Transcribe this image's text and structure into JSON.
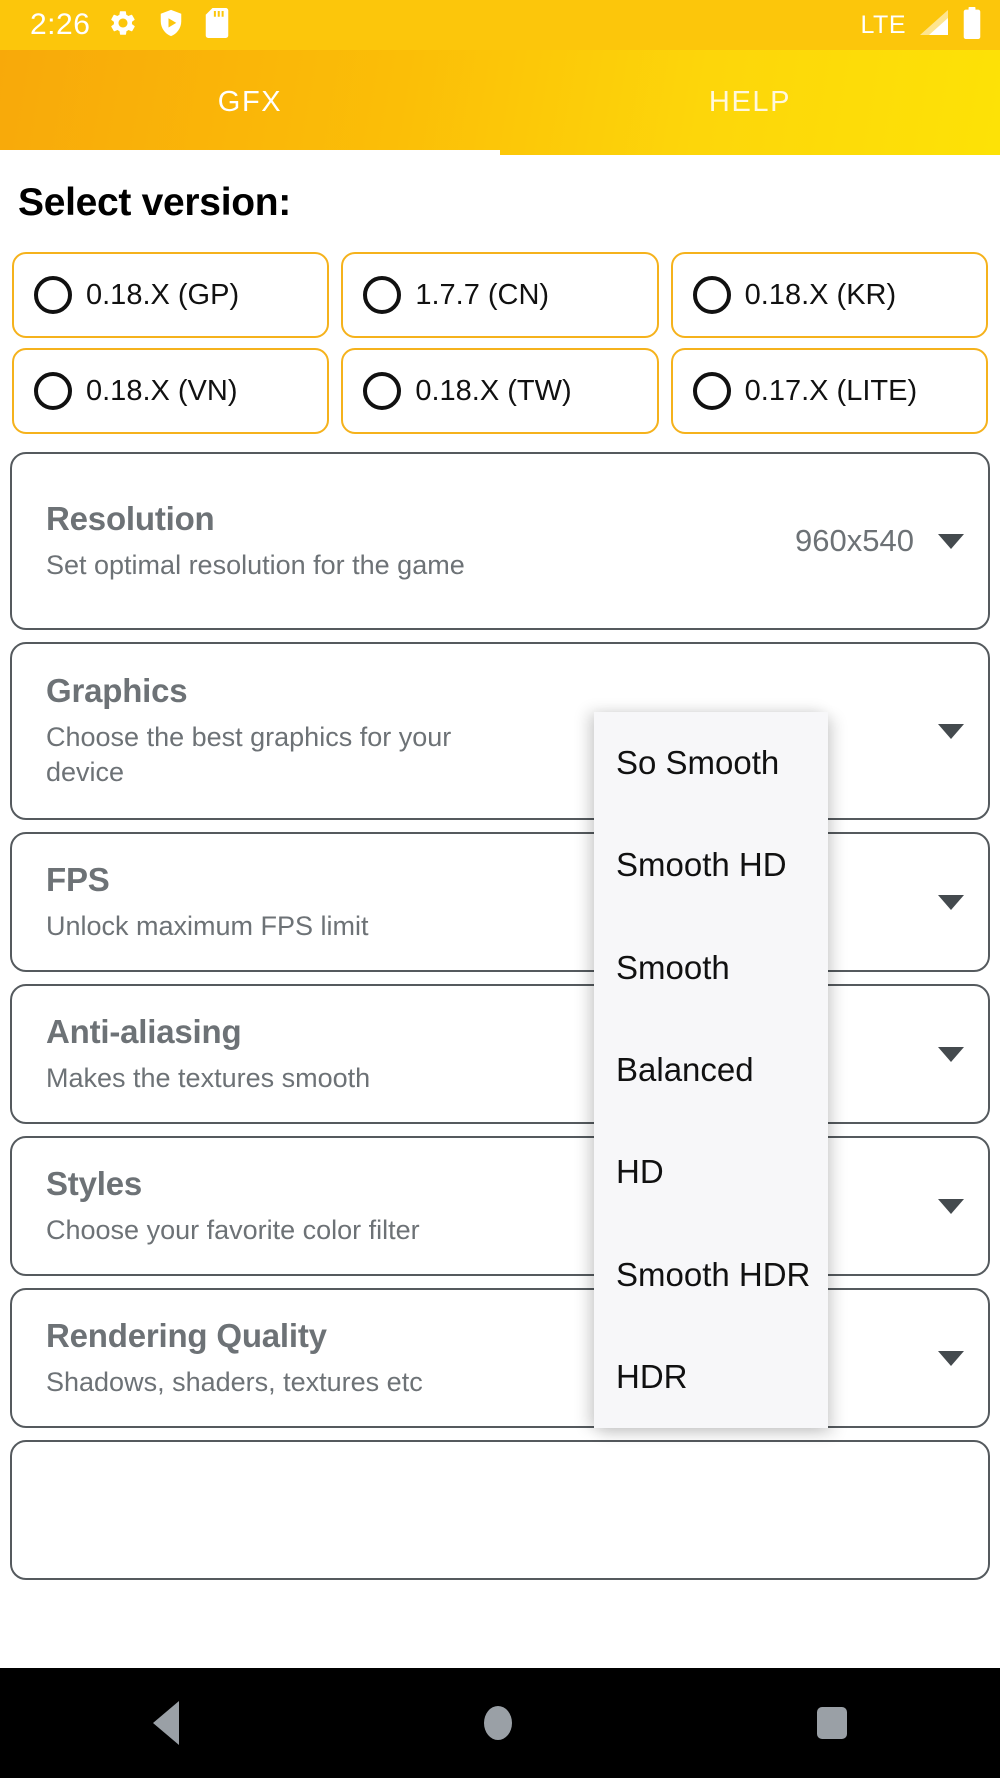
{
  "status_bar": {
    "time": "2:26",
    "left_icons": [
      "gear-icon",
      "play-protect-shield-icon",
      "sd-card-icon"
    ],
    "network_label": "LTE",
    "right_icons": [
      "signal-icon",
      "battery-icon"
    ],
    "background_color": "#fcc60b"
  },
  "tabs": {
    "active_index": 0,
    "items": [
      {
        "label": "GFX"
      },
      {
        "label": "HELP"
      }
    ]
  },
  "main": {
    "section_title": "Select version:",
    "versions": [
      {
        "label": "0.18.X (GP)",
        "selected": false
      },
      {
        "label": "1.7.7 (CN)",
        "selected": false
      },
      {
        "label": "0.18.X (KR)",
        "selected": false
      },
      {
        "label": "0.18.X (VN)",
        "selected": false
      },
      {
        "label": "0.18.X (TW)",
        "selected": false
      },
      {
        "label": "0.17.X (LITE)",
        "selected": false
      }
    ],
    "cards": [
      {
        "title": "Resolution",
        "subtitle": "Set optimal resolution for the game",
        "value": "960x540"
      },
      {
        "title": "Graphics",
        "subtitle": "Choose the best graphics for your device",
        "value": ""
      },
      {
        "title": "FPS",
        "subtitle": "Unlock maximum FPS limit",
        "value": ""
      },
      {
        "title": "Anti-aliasing",
        "subtitle": "Makes the textures smooth",
        "value": ""
      },
      {
        "title": "Styles",
        "subtitle": "Choose your favorite color filter",
        "value": ""
      },
      {
        "title": "Rendering Quality",
        "subtitle": "Shadows, shaders, textures etc",
        "value": ""
      }
    ]
  },
  "dropdown": {
    "open": true,
    "owner": "Graphics",
    "options": [
      {
        "label": "So Smooth"
      },
      {
        "label": "Smooth HD"
      },
      {
        "label": "Smooth"
      },
      {
        "label": "Balanced"
      },
      {
        "label": "HD"
      },
      {
        "label": "Smooth HDR"
      },
      {
        "label": "HDR"
      }
    ]
  },
  "navigation_bar": {
    "buttons": [
      "back-button",
      "home-button",
      "recents-button"
    ]
  },
  "colors": {
    "accent": "#fcc60b",
    "chip_border": "#f5b21c",
    "card_border": "#555a5e",
    "card_text": "#6d7276"
  }
}
